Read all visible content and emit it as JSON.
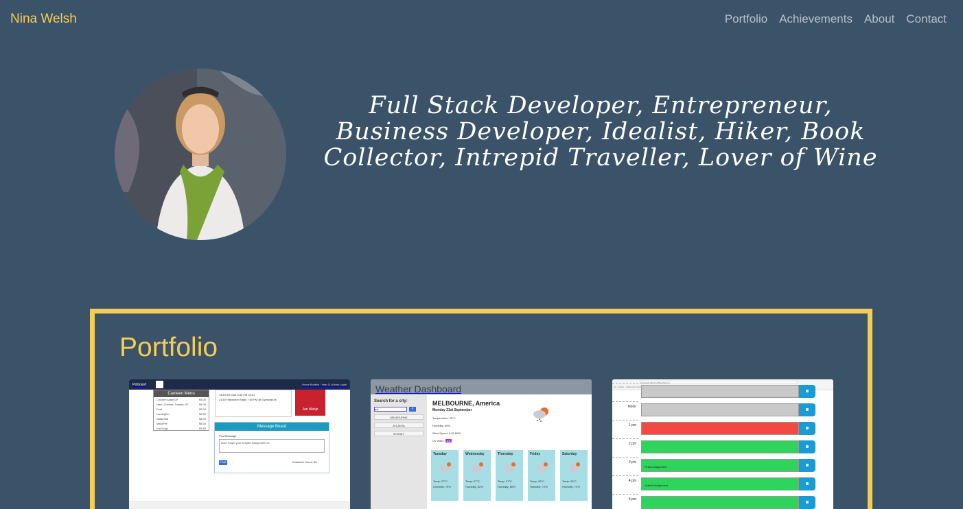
{
  "nav": {
    "brand": "Nina Welsh",
    "links": [
      "Portfolio",
      "Achievements",
      "About",
      "Contact"
    ]
  },
  "hero": {
    "tagline": "Full Stack Developer, Entrepreneur, Business Developer, Idealist, Hiker, Book Collector, Intrepid Traveller, Lover of Wine"
  },
  "portfolio": {
    "title": "Portfolio",
    "pinboard": {
      "brand": "Pinboard",
      "nav": "Home  Bulletin · Year 11  Admin Login",
      "menu_title": "Canteen Menu",
      "menu_items": [
        {
          "name": "Chicken salad GF",
          "price": "$5.00"
        },
        {
          "name": "Ham, Cheese, Tomato GF",
          "price": "$4.00"
        },
        {
          "name": "Fruit",
          "price": "$3.00"
        },
        {
          "name": "Lamington",
          "price": "$2.50"
        },
        {
          "name": "Salad Bar",
          "price": "$4.00"
        },
        {
          "name": "Meat Pie",
          "price": "$4.00"
        },
        {
          "name": "Hot Dogs",
          "price": "$3.50"
        }
      ],
      "events": [
        "14/10  Art Club  3:30 PM @ A1",
        "21/10  Halloween Night  7:00 PM @ Gymnasium"
      ],
      "book_label": "Jan Mahjo",
      "board_title": "Message Board",
      "post_label": "Post Message",
      "post_text": "Don't forget your English Assignment is!",
      "post_button": "Post",
      "char_count": "Character Count:  38"
    },
    "weather": {
      "title": "Weather Dashboard",
      "search_label": "Search for a city:",
      "search_value": "pal",
      "cities": [
        "MELBOURNE",
        "ATLANTA",
        "SYDNEY"
      ],
      "city": "MELBOURNE, America",
      "date": "Monday 21st September",
      "temperature": "Temperature: 28°C",
      "humidity": "Humidity: 60%",
      "wind": "Wind Speed: 8.80 MPH",
      "uv_label": "UV Index:",
      "uv_value": "0.5",
      "forecast": [
        {
          "day": "Tuesday",
          "temp": "Temp: 27°C",
          "hum": "Humidity: 75%"
        },
        {
          "day": "Wednesday",
          "temp": "Temp: 27°C",
          "hum": "Humidity: 82%"
        },
        {
          "day": "Thursday",
          "temp": "Temp: 27°C",
          "hum": "Humidity: 66%"
        },
        {
          "day": "Friday",
          "temp": "Temp: 28°C",
          "hum": "Humidity: 72%"
        },
        {
          "day": "Saturday",
          "temp": "Temp: 28°C",
          "hum": "Humidity: 73%"
        }
      ]
    },
    "planner": {
      "url": "ninawelsh.github.io/Day-Planner",
      "bookmarks": "ect · Gradu...  Statement overl...  teachable.fetch.i...  Customer Portal...  Atlassian unionba...  Google Scholar  Crypto Assistance  CryptoCruise  Jam Badge",
      "hours": [
        {
          "label": "",
          "state": "past",
          "text": ""
        },
        {
          "label": "Noon",
          "state": "past",
          "text": ""
        },
        {
          "label": "1 pm",
          "state": "present",
          "text": ""
        },
        {
          "label": "2 pm",
          "state": "future",
          "text": ""
        },
        {
          "label": "3 pm",
          "state": "future",
          "text": "Finish Assignment"
        },
        {
          "label": "4 pm",
          "state": "future",
          "text": "Submit Assignment"
        },
        {
          "label": "5 pm",
          "state": "future",
          "text": ""
        }
      ]
    }
  },
  "colors": {
    "background": "#3b5368",
    "accent": "#f6cd54",
    "nav_link": "#b7c0c8"
  }
}
